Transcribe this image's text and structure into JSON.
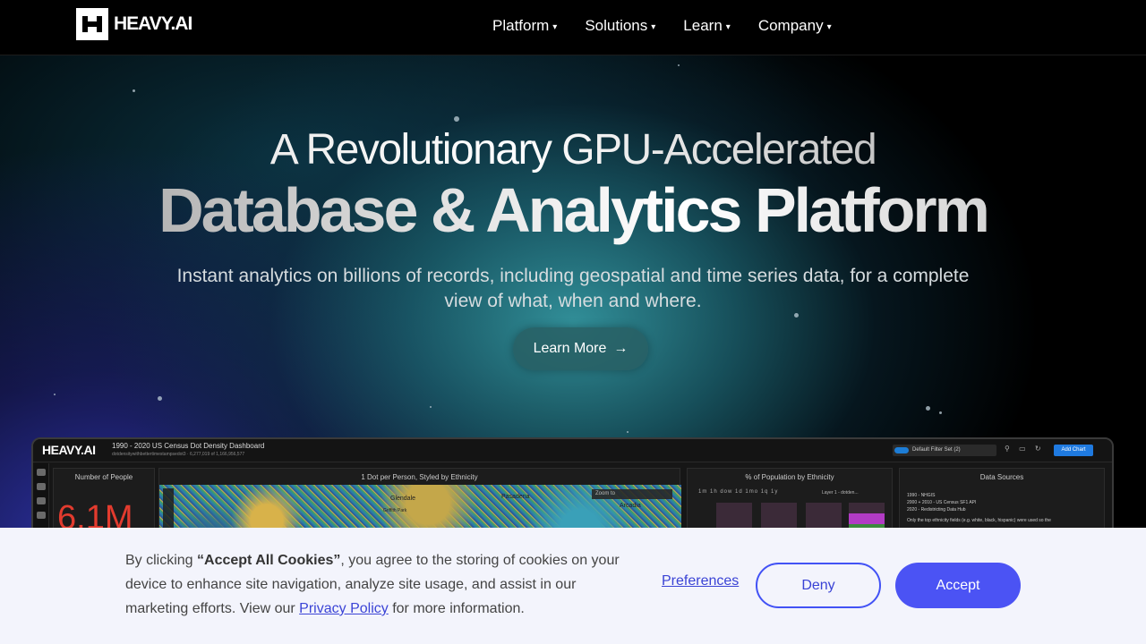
{
  "brand": {
    "name": "HEAVY.AI"
  },
  "nav": {
    "items": [
      {
        "label": "Platform"
      },
      {
        "label": "Solutions"
      },
      {
        "label": "Learn"
      },
      {
        "label": "Company"
      }
    ],
    "caret": "▾"
  },
  "hero": {
    "title_line1": "A Revolutionary GPU-Accelerated",
    "title_line2": "Database & Analytics Platform",
    "subtitle": "Instant analytics on billions of records, including geospatial and time series data, for a complete view of what, when and where.",
    "cta_label": "Learn More",
    "cta_arrow": "→"
  },
  "dashboard": {
    "logo": "HEAVY.AI",
    "title": "1990 - 2020 US Census Dot Density Dashboard",
    "subtitle": "dotdensitywithbettertimestampsedot3 · 6,277,019 of 1,166,956,577",
    "filter_set": "Default Filter Set (2)",
    "add_chart": "Add Chart",
    "panels": {
      "people_title": "Number of People",
      "people_value": "6.1M",
      "map_title": "1 Dot per Person, Styled by Ethnicity",
      "map_labels": [
        "Glendale",
        "Pasadena",
        "Arcadia",
        "Griffith Park"
      ],
      "zoom_placeholder": "Zoom to",
      "ethnicity_title": "% of Population by Ethnicity",
      "time_tabs": "1m 1h dow 1d 1mo 1q 1y",
      "layer_label": "Layer 1 - dotden...",
      "sources_title": "Data Sources",
      "sources_lines": [
        "1990 - NHGIS",
        "2000 + 2010 - US Census SF1 API",
        "2020 - Redistricting Data Hub",
        "Only the top ethnicity fields (e.g. white, black, hispanic) were used so the"
      ]
    }
  },
  "cookie": {
    "text_before": "By clicking ",
    "text_bold": "“Accept All Cookies”",
    "text_after": ", you agree to the storing of cookies on your device to enhance site navigation, analyze site usage, and assist in our marketing efforts. View our ",
    "privacy_link": "Privacy Policy",
    "text_end": " for more information.",
    "preferences_label": "Preferences",
    "deny_label": "Deny",
    "accept_label": "Accept"
  },
  "colors": {
    "accent": "#4b53f4",
    "nav_bg": "#000000",
    "cookie_bg": "#f3f4fc",
    "people_value": "#e23b2e"
  }
}
